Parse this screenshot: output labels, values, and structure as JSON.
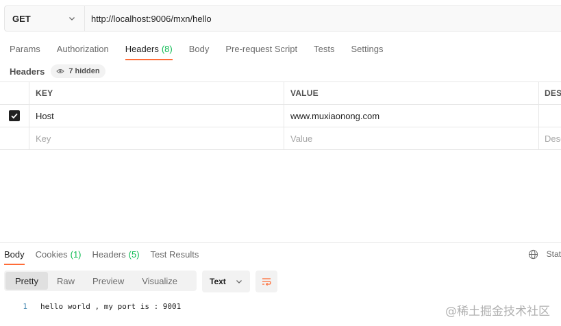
{
  "request": {
    "method": "GET",
    "url": "http://localhost:9006/mxn/hello"
  },
  "request_tabs": [
    {
      "label": "Params",
      "count": ""
    },
    {
      "label": "Authorization",
      "count": ""
    },
    {
      "label": "Headers",
      "count": "(8)"
    },
    {
      "label": "Body",
      "count": ""
    },
    {
      "label": "Pre-request Script",
      "count": ""
    },
    {
      "label": "Tests",
      "count": ""
    },
    {
      "label": "Settings",
      "count": ""
    }
  ],
  "headers_section": {
    "title": "Headers",
    "hidden_label": "7 hidden"
  },
  "headers_table": {
    "columns": {
      "key": "KEY",
      "value": "VALUE",
      "description": "DES"
    },
    "rows": [
      {
        "checked": true,
        "key": "Host",
        "value": "www.muxiaonong.com",
        "description": ""
      }
    ],
    "placeholder": {
      "key": "Key",
      "value": "Value",
      "description": "Desc"
    }
  },
  "response_tabs": [
    {
      "label": "Body",
      "count": ""
    },
    {
      "label": "Cookies",
      "count": "(1)"
    },
    {
      "label": "Headers",
      "count": "(5)"
    },
    {
      "label": "Test Results",
      "count": ""
    }
  ],
  "status_label": "Stat",
  "view_modes": [
    "Pretty",
    "Raw",
    "Preview",
    "Visualize"
  ],
  "format": "Text",
  "body_lines": [
    {
      "number": "1",
      "text": "hello world , my port is : 9001"
    }
  ],
  "watermark": "@稀土掘金技术社区",
  "colors": {
    "accent": "#ff6c37",
    "count_green": "#0cbb52"
  }
}
